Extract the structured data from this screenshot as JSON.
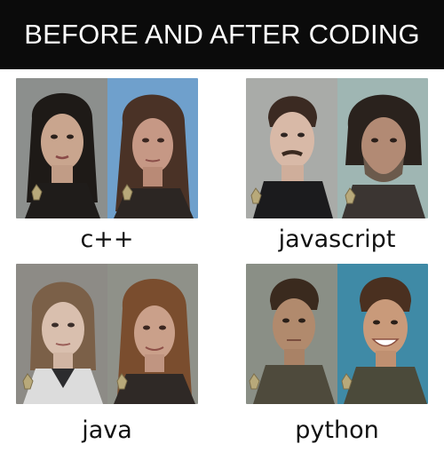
{
  "header": {
    "title": "BEFORE AND AFTER CODING"
  },
  "panels": [
    {
      "label": "c++"
    },
    {
      "label": "javascript"
    },
    {
      "label": "java"
    },
    {
      "label": "python"
    }
  ],
  "colors": {
    "header_bg": "#0b0b0b",
    "page_bg": "#ffffff"
  }
}
